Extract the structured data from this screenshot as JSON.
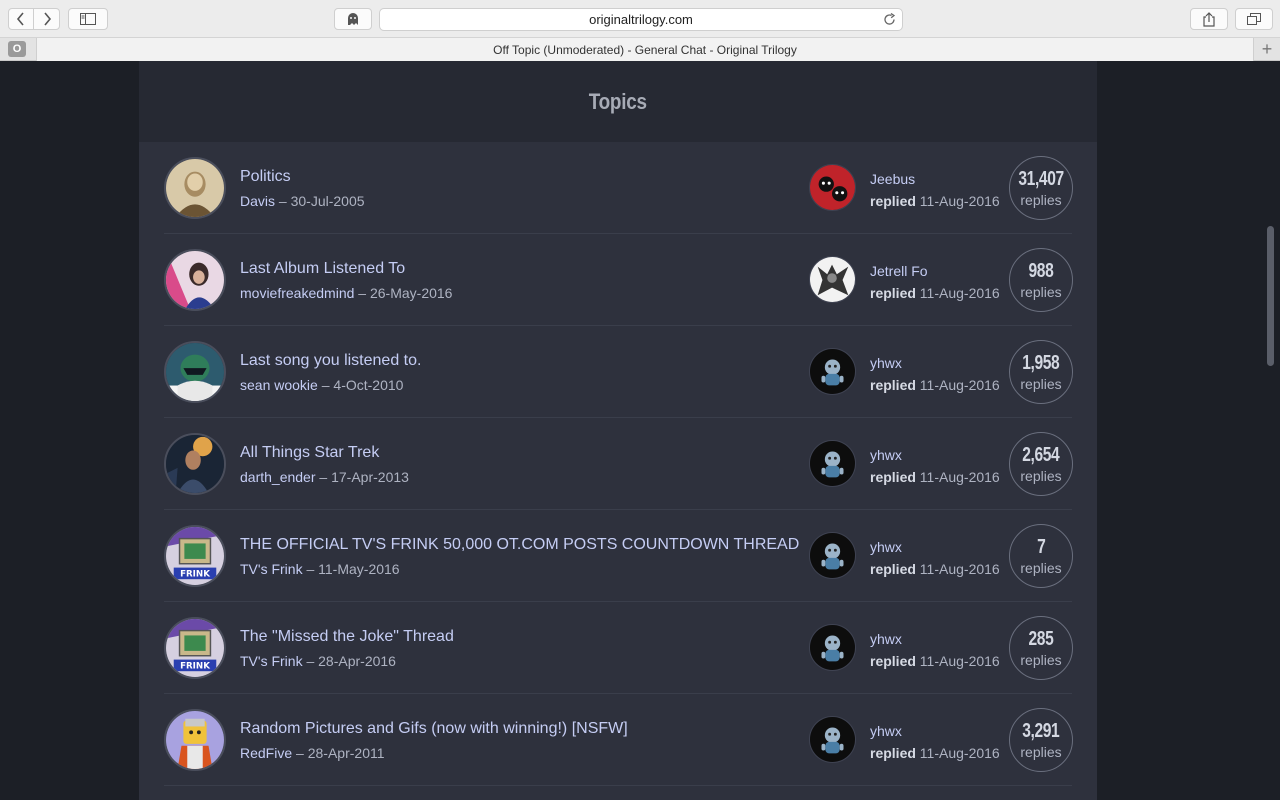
{
  "browser": {
    "url": "originaltrilogy.com",
    "tab_title": "Off Topic (Unmoderated) - General Chat - Original Trilogy",
    "favicon_letter": "O"
  },
  "section": {
    "title": "Topics"
  },
  "topics": [
    {
      "title": "Politics",
      "author": "Davis",
      "date": "30-Jul-2005",
      "last_user": "Jeebus",
      "replied_label": "replied",
      "last_date": "11-Aug-2016",
      "count": "31,407",
      "count_label": "replies"
    },
    {
      "title": "Last Album Listened To",
      "author": "moviefreakedmind",
      "date": "26-May-2016",
      "last_user": "Jetrell Fo",
      "replied_label": "replied",
      "last_date": "11-Aug-2016",
      "count": "988",
      "count_label": "replies"
    },
    {
      "title": "Last song you listened to.",
      "author": "sean wookie",
      "date": "4-Oct-2010",
      "last_user": "yhwx",
      "replied_label": "replied",
      "last_date": "11-Aug-2016",
      "count": "1,958",
      "count_label": "replies"
    },
    {
      "title": "All Things Star Trek",
      "author": "darth_ender",
      "date": "17-Apr-2013",
      "last_user": "yhwx",
      "replied_label": "replied",
      "last_date": "11-Aug-2016",
      "count": "2,654",
      "count_label": "replies"
    },
    {
      "title": "THE OFFICIAL TV'S FRINK 50,000 OT.COM POSTS COUNTDOWN THREAD",
      "author": "TV's Frink",
      "date": "11-May-2016",
      "last_user": "yhwx",
      "replied_label": "replied",
      "last_date": "11-Aug-2016",
      "count": "7",
      "count_label": "replies",
      "avatar_text": "FRINK"
    },
    {
      "title": "The \"Missed the Joke\" Thread",
      "author": "TV's Frink",
      "date": "28-Apr-2016",
      "last_user": "yhwx",
      "replied_label": "replied",
      "last_date": "11-Aug-2016",
      "count": "285",
      "count_label": "replies",
      "avatar_text": "FRINK"
    },
    {
      "title": "Random Pictures and Gifs (now with winning!) [NSFW]",
      "author": "RedFive",
      "date": "28-Apr-2011",
      "last_user": "yhwx",
      "replied_label": "replied",
      "last_date": "11-Aug-2016",
      "count": "3,291",
      "count_label": "replies"
    }
  ],
  "meta_separator": "–",
  "colors": {
    "panel": "#2e313d",
    "header": "#262933",
    "link": "#c5cdf4",
    "page_bg": "#1c1f26"
  }
}
